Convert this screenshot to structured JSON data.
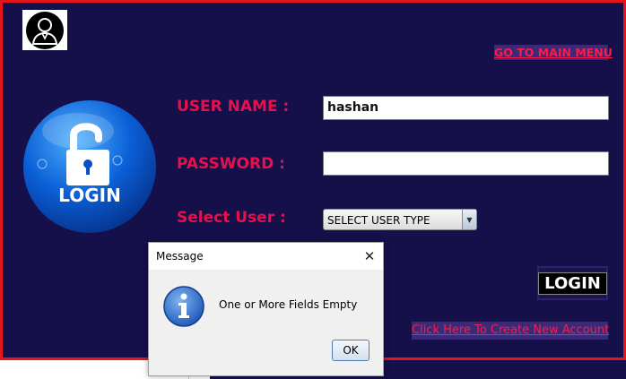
{
  "header": {
    "menu_link": "GO TO MAIN MENU",
    "avatar_icon": "user-icon"
  },
  "badge": {
    "text": "LOGIN",
    "icon": "lock-icon"
  },
  "form": {
    "username_label": "USER NAME :",
    "username_value": "hashan",
    "password_label": "PASSWORD :",
    "password_value": "",
    "usertype_label": "Select User :",
    "usertype_selected": "SELECT USER TYPE"
  },
  "actions": {
    "login_label": "LOGIN",
    "create_account_link": "Click Here To Create New Account"
  },
  "dialog": {
    "title": "Message",
    "message": "One or More Fields Empty",
    "ok_label": "OK",
    "close_symbol": "✕",
    "icon": "info-icon"
  },
  "colors": {
    "background": "#150f4a",
    "border": "#e8141c",
    "label": "#e8104c",
    "link": "#ff1a4a"
  }
}
